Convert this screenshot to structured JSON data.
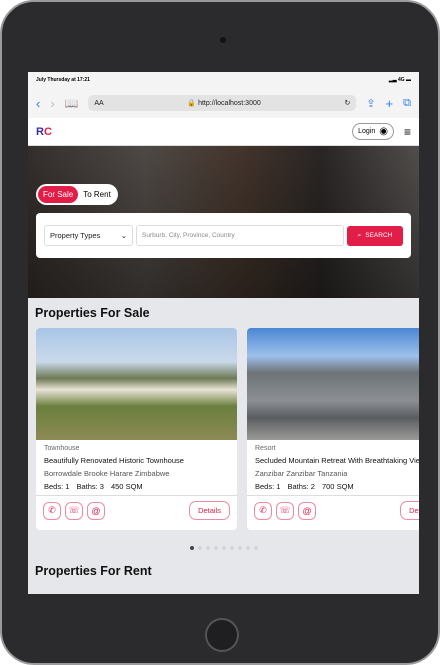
{
  "status": {
    "time": "July Thursday at 17:21",
    "network": "4G"
  },
  "browser": {
    "text_size": "AA",
    "url": "http://localhost:3000"
  },
  "header": {
    "logo": "RC",
    "login": "Login"
  },
  "hero": {
    "tabs": [
      "For Sale",
      "To Rent"
    ],
    "property_types": "Property Types",
    "search_placeholder": "Surburb, City, Province, Country",
    "search_label": "SEARCH"
  },
  "sale": {
    "title": "Properties For Sale",
    "cards": [
      {
        "type": "Townhouse",
        "title": "Beautifully Renovated Historic Townhouse",
        "location": "Borrowdale Brooke Harare Zimbabwe",
        "beds": "Beds: 1",
        "baths": "Baths: 3",
        "area": "450 SQM",
        "details": "Details"
      },
      {
        "type": "Resort",
        "title": "Secluded Mountain Retreat With Breathtaking Views",
        "location": "Zanzibar Zanzibar Tanzania",
        "beds": "Beds: 1",
        "baths": "Baths: 2",
        "area": "700 SQM",
        "details": "Details"
      }
    ],
    "pages": 9,
    "active_page": 1
  },
  "rent": {
    "title": "Properties For Rent"
  },
  "colors": {
    "accent": "#e11d48"
  }
}
